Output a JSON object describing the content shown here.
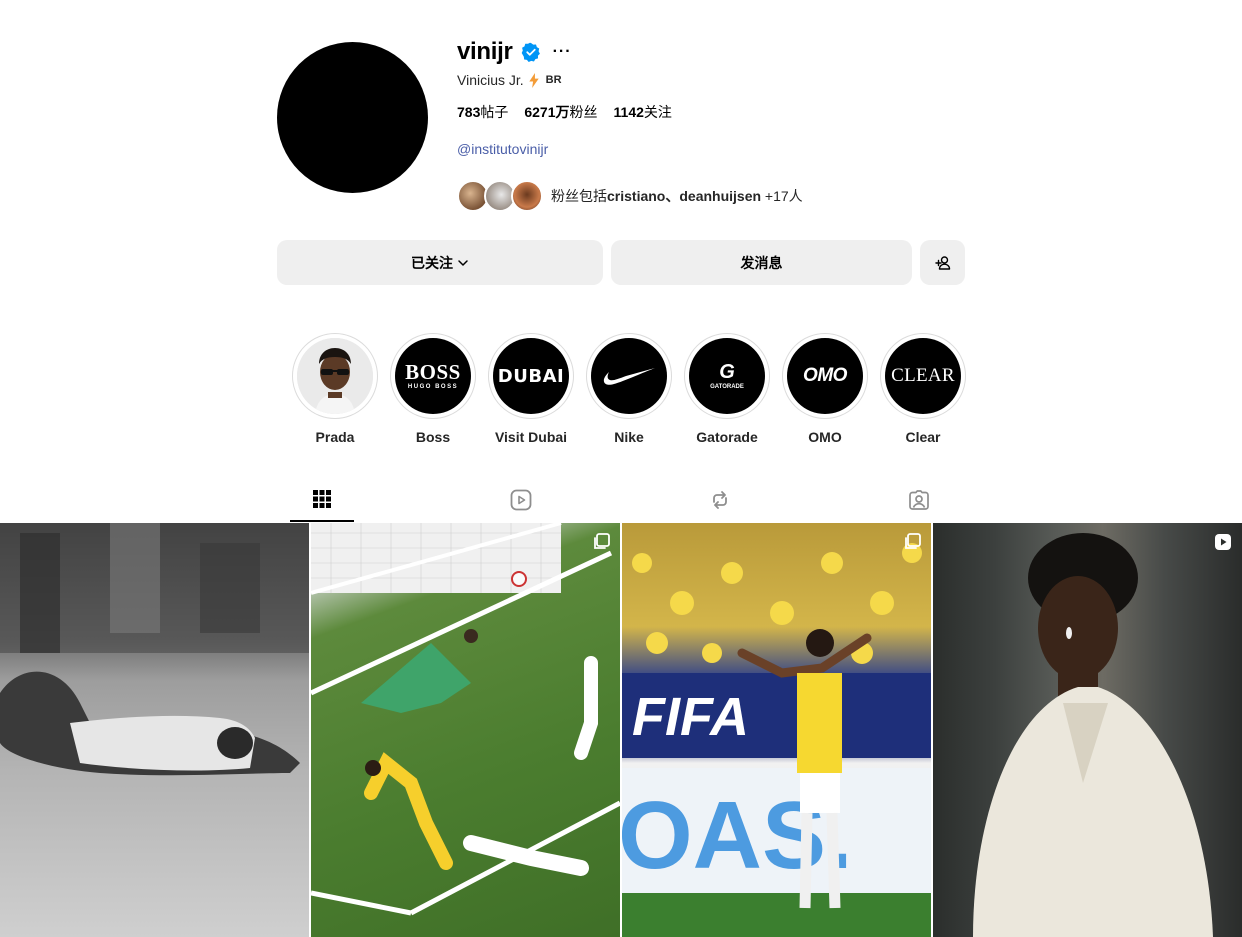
{
  "profile": {
    "username": "vinijr",
    "more": "···",
    "full_name": "Vinicius Jr.",
    "country": "BR",
    "stats": {
      "posts_count": "783",
      "posts_label": "帖子",
      "followers_count": "6271万",
      "followers_label": "粉丝",
      "following_count": "1142",
      "following_label": "关注"
    },
    "link": "@institutovinijr",
    "followed_by": {
      "prefix": "粉丝包括",
      "names": "cristiano、deanhuijsen",
      "suffix": " +17人"
    }
  },
  "actions": {
    "following_label": "已关注",
    "message_label": "发消息"
  },
  "highlights": [
    {
      "label": "Prada"
    },
    {
      "label": "Boss",
      "logo": "BOSS",
      "sub": "HUGO BOSS"
    },
    {
      "label": "Visit Dubai",
      "logo": "DUBAI"
    },
    {
      "label": "Nike"
    },
    {
      "label": "Gatorade",
      "logo": "GATORADE"
    },
    {
      "label": "OMO",
      "logo": "OMO"
    },
    {
      "label": "Clear",
      "logo": "CLEAR"
    }
  ],
  "tabs": [
    "grid-icon",
    "reels-icon",
    "reposts-icon",
    "tagged-icon"
  ],
  "colors": {
    "link": "#4a5ea8",
    "verified": "#0095f6",
    "button_bg": "#efefef",
    "bolt": "#f39c38"
  }
}
